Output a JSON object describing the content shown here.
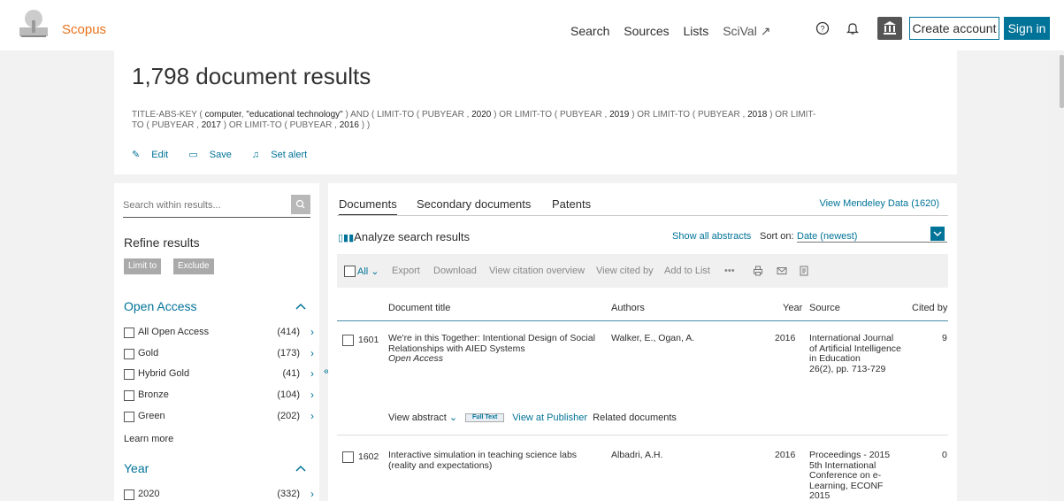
{
  "header": {
    "brand": "Scopus",
    "nav": [
      "Search",
      "Sources",
      "Lists",
      "SciVal ↗"
    ],
    "create_account": "Create account",
    "sign_in": "Sign in"
  },
  "results": {
    "title": "1,798 document results",
    "query_parts": [
      "TITLE-ABS-KEY ( ",
      "computer",
      ",  ",
      "\"educational technology\"",
      " )  AND  ( LIMIT-TO ( PUBYEAR ,  ",
      "2020",
      " )  OR  LIMIT-TO ( PUBYEAR ,  ",
      "2019",
      " )  OR  LIMIT-TO ( PUBYEAR ,  ",
      "2018",
      " )  OR  LIMIT-",
      "TO ( PUBYEAR ,  ",
      "2017",
      " )  OR  LIMIT-TO ( PUBYEAR ,  ",
      "2016",
      " ) )"
    ],
    "actions": [
      "Edit",
      "Save",
      "Set alert"
    ]
  },
  "refine": {
    "search_placeholder": "Search within results...",
    "title": "Refine results",
    "limit_to": "Limit to",
    "exclude": "Exclude",
    "open_access": {
      "title": "Open Access",
      "items": [
        {
          "label": "All Open Access",
          "count": "(414)"
        },
        {
          "label": "Gold",
          "count": "(173)"
        },
        {
          "label": "Hybrid Gold",
          "count": "(41)"
        },
        {
          "label": "Bronze",
          "count": "(104)"
        },
        {
          "label": "Green",
          "count": "(202)"
        }
      ],
      "learn_more": "Learn more"
    },
    "year": {
      "title": "Year",
      "items": [
        {
          "label": "2020",
          "count": "(332)"
        }
      ]
    }
  },
  "main": {
    "tabs": [
      "Documents",
      "Secondary documents",
      "Patents"
    ],
    "mendeley": "View Mendeley Data (1620)",
    "analyze": "Analyze search results",
    "show_abstracts": "Show all abstracts",
    "sort_label": "Sort on:",
    "sort_value": "Date (newest)",
    "toolbar": {
      "all": "All",
      "export": "Export",
      "download": "Download",
      "citation_overview": "View citation overview",
      "cited_by": "View cited by",
      "add_to_list": "Add to List",
      "more": "•••"
    },
    "columns": [
      "Document title",
      "Authors",
      "Year",
      "Source",
      "Cited by"
    ],
    "rows": [
      {
        "num": "1601",
        "title": "We're in this Together: Intentional Design of Social Relationships with AIED Systems",
        "oa": "Open Access",
        "authors": "Walker, E., Ogan, A.",
        "year": "2016",
        "source": "International Journal of Artificial Intelligence in Education",
        "source_detail": "26(2), pp. 713-729",
        "cited": "9"
      },
      {
        "num": "1602",
        "title": "Interactive simulation in teaching science labs (reality and expectations)",
        "authors": "Albadri, A.H.",
        "year": "2016",
        "source": "Proceedings - 2015 5th International Conference on e-Learning, ECONF 2015",
        "cited": "0"
      }
    ],
    "row_actions": {
      "view_abstract": "View abstract",
      "full_text": "Full Text",
      "view_at_publisher": "View at Publisher",
      "related": "Related documents"
    }
  }
}
